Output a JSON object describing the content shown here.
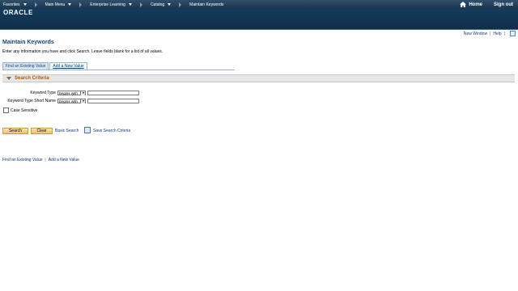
{
  "topnav": {
    "items": [
      {
        "label": "Favorites",
        "caret": true
      },
      {
        "label": "Main Menu",
        "caret": true
      },
      {
        "label": "Enterprise Learning",
        "caret": true
      },
      {
        "label": "Catalog",
        "caret": true
      },
      {
        "label": "Maintain Keywords",
        "caret": false
      }
    ],
    "home_label": "Home",
    "signout_label": "Sign out",
    "bg_color": "#1f3f5c"
  },
  "brand": {
    "logo_text": "ORACLE"
  },
  "util_links": {
    "new_window": "New Window",
    "help": "Help"
  },
  "page": {
    "title": "Maintain Keywords",
    "instructions": "Enter any information you have and click Search. Leave fields blank for a list of all values."
  },
  "tabs": [
    {
      "label": "Find an Existing Value",
      "active": true
    },
    {
      "label": "Add a New Value",
      "active": false
    }
  ],
  "section": {
    "title": "Search Criteria"
  },
  "form": {
    "keyword_type": {
      "label": "Keyword Type",
      "operator": "begins with",
      "value": ""
    },
    "keyword_type_short": {
      "label": "Keyword Type Short Name",
      "operator": "begins with",
      "value": ""
    },
    "case_sensitive": {
      "label": "Case Sensitive",
      "checked": false
    }
  },
  "buttons": {
    "search": "Search",
    "clear": "Clear",
    "basic_search": "Basic Search",
    "save_search": "Save Search Criteria"
  },
  "bottom_links": {
    "find_existing": "Find an Existing Value",
    "add_new": "Add a New Value"
  },
  "colors": {
    "accent_orange": "#b35a00",
    "link_blue": "#103b7a",
    "title_blue": "#19467a"
  }
}
